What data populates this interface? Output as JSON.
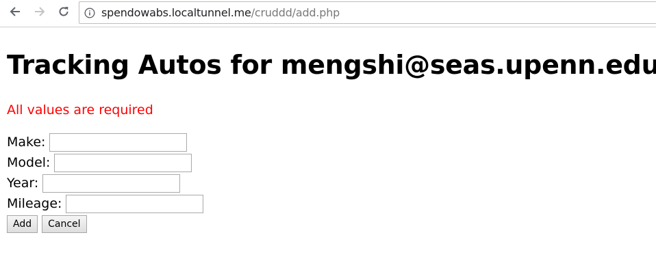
{
  "browser": {
    "url_host": "spendowabs.localtunnel.me",
    "url_path": "/cruddd/add.php",
    "icons": {
      "back": "arrow-left-icon",
      "forward": "arrow-right-icon",
      "reload": "reload-icon",
      "info": "info-icon"
    }
  },
  "page": {
    "title": "Tracking Autos for mengshi@seas.upenn.edu",
    "error": "All values are required",
    "error_color": "#ff0000",
    "form": {
      "make_label": "Make:",
      "make_value": "",
      "model_label": "Model:",
      "model_value": "",
      "year_label": "Year:",
      "year_value": "",
      "mileage_label": "Mileage:",
      "mileage_value": "",
      "add_label": "Add",
      "cancel_label": "Cancel"
    }
  }
}
